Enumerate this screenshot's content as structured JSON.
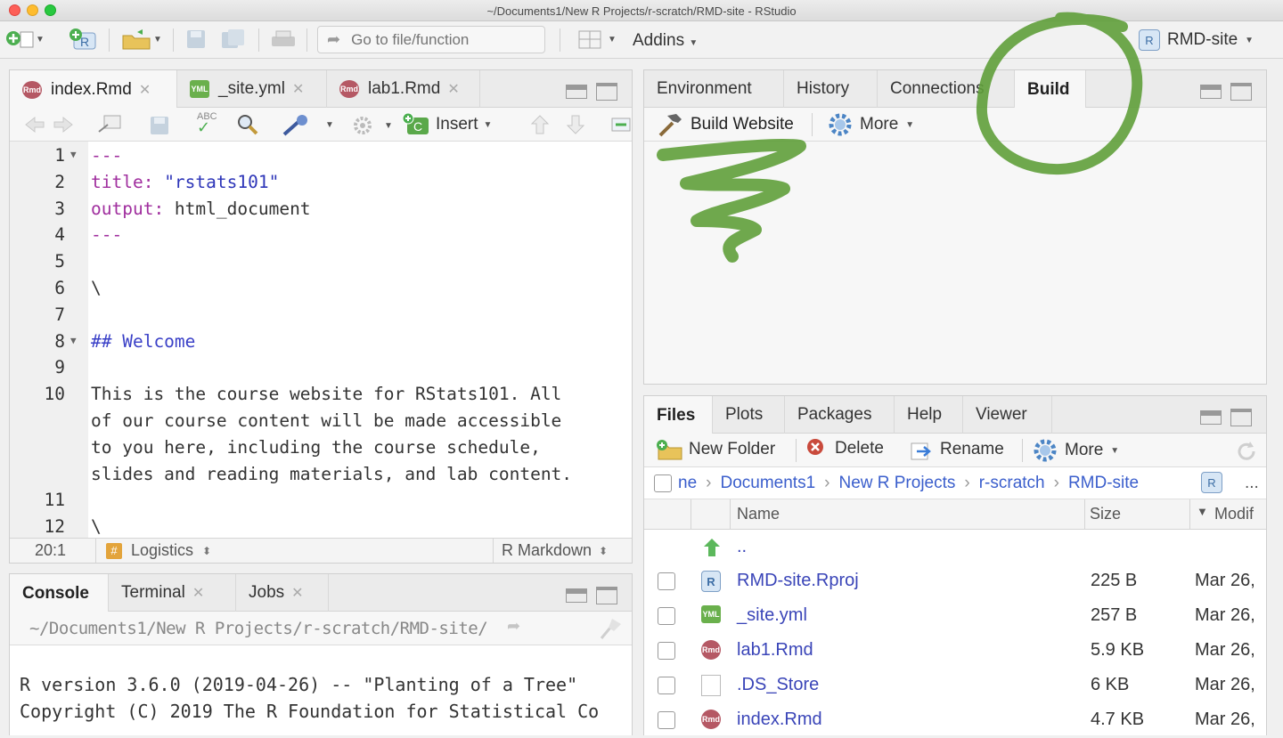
{
  "window": {
    "title": "~/Documents1/New R Projects/r-scratch/RMD-site - RStudio"
  },
  "toolbar": {
    "goto_placeholder": "Go to file/function",
    "addins_label": "Addins",
    "project_label": "RMD-site",
    "project_badge": "R"
  },
  "source": {
    "tabs": [
      {
        "label": "index.Rmd",
        "badge": "Rmd",
        "icon": "rmd-file-icon"
      },
      {
        "label": "_site.yml",
        "badge": "YML",
        "icon": "yml-file-icon"
      },
      {
        "label": "lab1.Rmd",
        "badge": "Rmd",
        "icon": "rmd-file-icon"
      }
    ],
    "insert_label": "Insert",
    "lines": [
      {
        "n": "1",
        "text": "---"
      },
      {
        "n": "2",
        "key": "title:",
        "val": " \"rstats101\""
      },
      {
        "n": "3",
        "key": "output:",
        "plain": " html_document"
      },
      {
        "n": "4",
        "text": "---"
      },
      {
        "n": "5",
        "text": ""
      },
      {
        "n": "6",
        "text": "\\"
      },
      {
        "n": "7",
        "text": ""
      },
      {
        "n": "8",
        "heading": "## Welcome"
      },
      {
        "n": "9",
        "text": ""
      },
      {
        "n": "10",
        "text": "This is the course website for RStats101. All"
      },
      {
        "n": "",
        "text": "of our course content will be made accessible"
      },
      {
        "n": "",
        "text": "to you here, including the course schedule,"
      },
      {
        "n": "",
        "text": "slides and reading materials, and lab content."
      },
      {
        "n": "11",
        "text": ""
      },
      {
        "n": "12",
        "text": "\\"
      }
    ],
    "status": {
      "position": "20:1",
      "section": "Logistics",
      "section_badge": "#",
      "mode": "R Markdown"
    }
  },
  "console": {
    "tabs": [
      "Console",
      "Terminal",
      "Jobs"
    ],
    "path": "~/Documents1/New R Projects/r-scratch/RMD-site/",
    "lines": [
      "R version 3.6.0 (2019-04-26) -- \"Planting of a Tree\"",
      "Copyright (C) 2019 The R Foundation for Statistical Co"
    ]
  },
  "environment": {
    "tabs": [
      "Environment",
      "History",
      "Connections",
      "Build"
    ],
    "active_tab": "Build",
    "build_website_label": "Build Website",
    "more_label": "More"
  },
  "files": {
    "tabs": [
      "Files",
      "Plots",
      "Packages",
      "Help",
      "Viewer"
    ],
    "new_folder_label": "New Folder",
    "delete_label": "Delete",
    "rename_label": "Rename",
    "more_label": "More",
    "breadcrumb": [
      "ne",
      "Documents1",
      "New R Projects",
      "r-scratch",
      "RMD-site"
    ],
    "breadcrumb_more": "...",
    "columns": {
      "name": "Name",
      "size": "Size",
      "modified": "Modif"
    },
    "up_label": "..",
    "rows": [
      {
        "name": "RMD-site.Rproj",
        "size": "225 B",
        "modified": "Mar 26,",
        "icon": "rproj-file-icon",
        "badge": "R"
      },
      {
        "name": "_site.yml",
        "size": "257 B",
        "modified": "Mar 26,",
        "icon": "yml-file-icon",
        "badge": "YML"
      },
      {
        "name": "lab1.Rmd",
        "size": "5.9 KB",
        "modified": "Mar 26,",
        "icon": "rmd-file-icon",
        "badge": "Rmd"
      },
      {
        "name": ".DS_Store",
        "size": "6 KB",
        "modified": "Mar 26,",
        "icon": "blank-file-icon",
        "badge": ""
      },
      {
        "name": "index.Rmd",
        "size": "4.7 KB",
        "modified": "Mar 26,",
        "icon": "rmd-file-icon",
        "badge": "Rmd"
      }
    ]
  },
  "colors": {
    "annotation_green": "#5f9e3a",
    "accent": "#3a5ecc"
  }
}
